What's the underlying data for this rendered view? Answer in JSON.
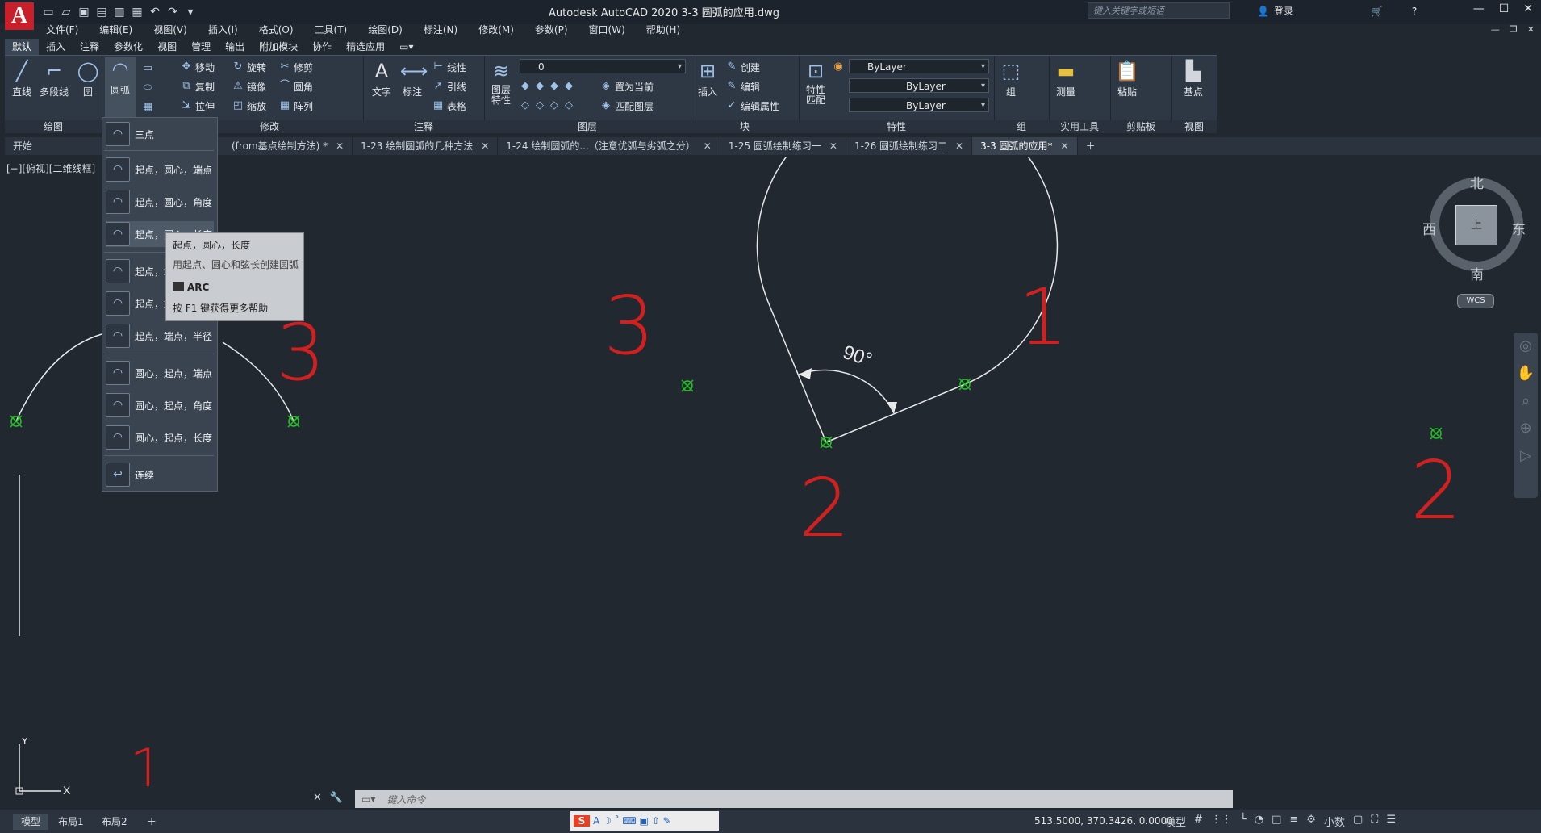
{
  "app": {
    "logo": "A",
    "title": "Autodesk AutoCAD 2020    3-3 圆弧的应用.dwg"
  },
  "quick_access": [
    "new-icon",
    "open-icon",
    "save-icon",
    "saveas-icon",
    "plot-icon",
    "print-icon",
    "undo-icon",
    "redo-icon",
    "menu-icon"
  ],
  "search": {
    "placeholder": "键入关键字或短语"
  },
  "user": {
    "login": "登录"
  },
  "menubar": [
    "文件(F)",
    "编辑(E)",
    "视图(V)",
    "插入(I)",
    "格式(O)",
    "工具(T)",
    "绘图(D)",
    "标注(N)",
    "修改(M)",
    "参数(P)",
    "窗口(W)",
    "帮助(H)"
  ],
  "ribbon_tabs": [
    "默认",
    "插入",
    "注释",
    "参数化",
    "视图",
    "管理",
    "输出",
    "附加模块",
    "协作",
    "精选应用"
  ],
  "ribbon": {
    "draw": {
      "title": "绘图",
      "line": "直线",
      "polyline": "多段线",
      "circle": "圆",
      "arc": "圆弧"
    },
    "modify": {
      "title": "修改",
      "move": "移动",
      "rotate": "旋转",
      "trim": "修剪",
      "copy": "复制",
      "mirror": "镜像",
      "fillet": "圆角",
      "stretch": "拉伸",
      "scale": "缩放",
      "array": "阵列"
    },
    "annotation": {
      "title": "注释",
      "text": "文字",
      "dimension": "标注",
      "linear": "线性",
      "leader": "引线",
      "table": "表格"
    },
    "layers": {
      "title": "图层",
      "props": "图层\n特性",
      "current_layer": "0",
      "make_current": "置为当前",
      "match_layer": "匹配图层"
    },
    "block": {
      "title": "块",
      "insert": "插入",
      "create": "创建",
      "edit": "编辑",
      "edit_attr": "编辑属性"
    },
    "properties": {
      "title": "特性",
      "match": "特性\n匹配",
      "color": "ByLayer",
      "linetype": "ByLayer",
      "lineweight": "ByLayer"
    },
    "groups": {
      "title": "组",
      "group": "组"
    },
    "utilities": {
      "title": "实用工具",
      "measure": "测量"
    },
    "clipboard": {
      "title": "剪贴板",
      "paste": "粘贴"
    },
    "view": {
      "title": "视图",
      "base": "基点"
    }
  },
  "doc_tabs": [
    {
      "label": "开始",
      "active": false,
      "closable": false
    },
    {
      "label": "(from基点绘制方法) *",
      "active": false,
      "closable": true
    },
    {
      "label": "1-23 绘制圆弧的几种方法",
      "active": false,
      "closable": true
    },
    {
      "label": "1-24 绘制圆弧的...（注意优弧与劣弧之分）",
      "active": false,
      "closable": true
    },
    {
      "label": "1-25 圆弧绘制练习一",
      "active": false,
      "closable": true
    },
    {
      "label": "1-26 圆弧绘制练习二",
      "active": false,
      "closable": true
    },
    {
      "label": "3-3 圆弧的应用*",
      "active": true,
      "closable": true
    }
  ],
  "viewport_label": "[−][俯视][二维线框]",
  "arc_menu": [
    "三点",
    "起点，圆心，端点",
    "起点，圆心，角度",
    "起点，圆心，长度",
    "起点，端点，角度",
    "起点，端点，方向",
    "起点，端点，半径",
    "圆心，起点，端点",
    "圆心，起点，角度",
    "圆心，起点，长度",
    "连续"
  ],
  "tooltip": {
    "title": "起点，圆心，长度",
    "desc": "用起点、圆心和弦长创建圆弧",
    "command": "ARC",
    "help": "按 F1 键获得更多帮助"
  },
  "drawing": {
    "angle_label": "90°",
    "labels": [
      {
        "text": "3"
      },
      {
        "text": "1"
      },
      {
        "text": "2"
      },
      {
        "text": "3"
      },
      {
        "text": "2"
      },
      {
        "text": "1"
      }
    ]
  },
  "compass": {
    "north": "北",
    "south": "南",
    "west": "西",
    "east": "东",
    "top": "上",
    "wcs": "WCS"
  },
  "ucs": {
    "x": "X",
    "y": "Y"
  },
  "command_line": {
    "placeholder": "键入命令"
  },
  "layout_tabs": [
    "模型",
    "布局1",
    "布局2"
  ],
  "status": {
    "coords": "513.5000, 370.3426, 0.0000",
    "mode": "模型",
    "units": "小数"
  },
  "colors": {
    "accent": "#c8202a",
    "drawing_bg": "#212830",
    "red_text": "#d02020",
    "marker": "#27c227"
  }
}
